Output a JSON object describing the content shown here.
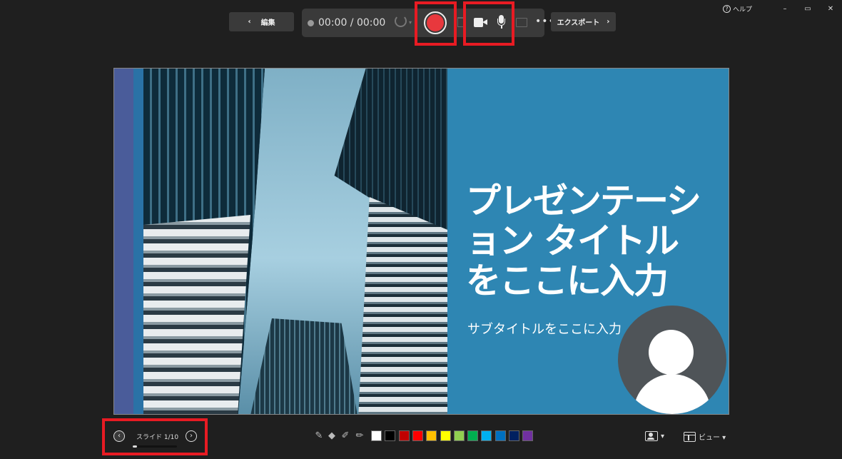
{
  "window": {
    "help_label": "ヘルプ",
    "minimize": "–",
    "restore": "▭",
    "close": "✕"
  },
  "toolbar": {
    "edit_label": "編集",
    "timer": "00:00 / 00:00",
    "export_label": "エクスポート",
    "more": "•••"
  },
  "slide": {
    "title": "プレゼンテーション タイトルをここに入力",
    "subtitle": "サブタイトルをここに入力"
  },
  "nav": {
    "prev": "‹",
    "next": "›",
    "slide_counter": "スライド 1/10",
    "progress_fraction": 0.1
  },
  "pen": {
    "colors": [
      "#ffffff",
      "#000000",
      "#c00000",
      "#ff0000",
      "#ffc000",
      "#ffff00",
      "#92d050",
      "#00b050",
      "#00b0f0",
      "#0070c0",
      "#002060",
      "#7030a0"
    ]
  },
  "view": {
    "camera_caret": "▾",
    "view_label": "ビュー ▾"
  }
}
